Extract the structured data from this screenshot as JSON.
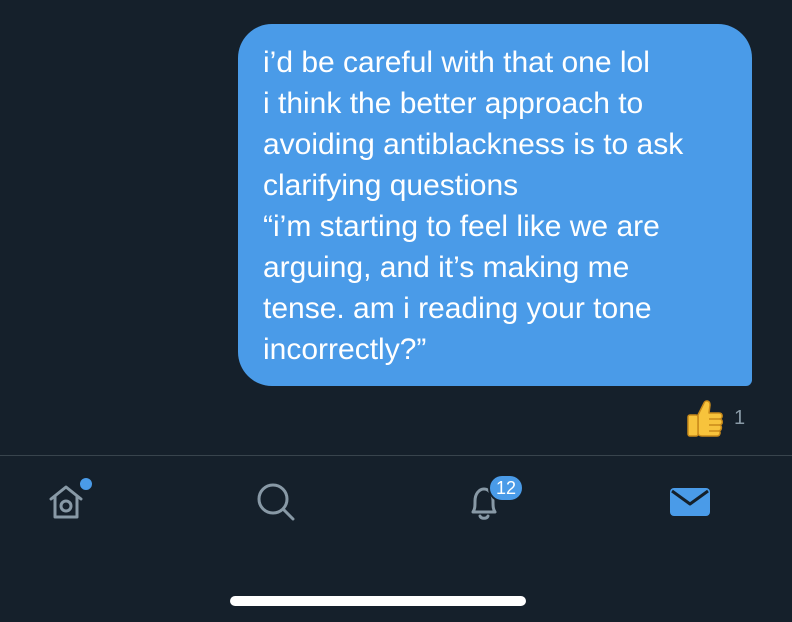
{
  "message": {
    "lines": [
      "i’d be careful with that one lol",
      "i think the better approach to",
      "avoiding antiblackness is to ask",
      "clarifying questions",
      "“i’m starting to feel like we are",
      "arguing, and it’s making me",
      "tense. am i reading your tone",
      "incorrectly?”"
    ]
  },
  "reaction": {
    "emoji": "👍",
    "icon": "thumbs-up-icon",
    "count": "1"
  },
  "tab_bar": {
    "home": {
      "icon": "home-icon",
      "has_dot": true
    },
    "search": {
      "icon": "search-icon"
    },
    "notifications": {
      "icon": "bell-icon",
      "badge": "12"
    },
    "messages": {
      "icon": "mail-icon",
      "active": true
    }
  },
  "colors": {
    "background": "#15202b",
    "bubble": "#4a9be8",
    "accent": "#4a9be8",
    "icon_inactive": "#8899a6",
    "divider": "#38444d"
  }
}
